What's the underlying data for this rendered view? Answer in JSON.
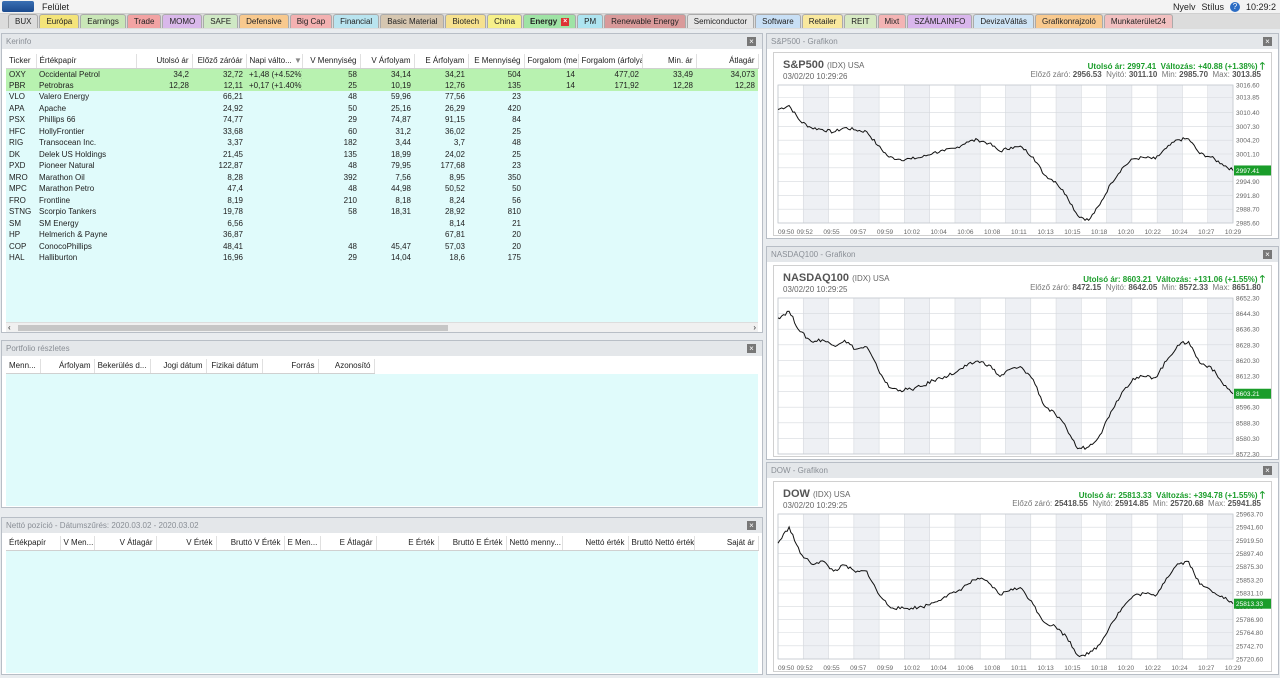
{
  "app": {
    "menu_label": "Felület",
    "lang_label": "Nyelv",
    "style_label": "Stílus",
    "time": "10:29:2"
  },
  "tabs": [
    {
      "label": "BUX",
      "color": "#dcdcdc"
    },
    {
      "label": "Európa",
      "color": "#f4e47a"
    },
    {
      "label": "Earnings",
      "color": "#c9e6b7"
    },
    {
      "label": "Trade",
      "color": "#f2a3a3"
    },
    {
      "label": "MOMO",
      "color": "#d9b8ea"
    },
    {
      "label": "SAFE",
      "color": "#cfe8c4"
    },
    {
      "label": "Defensive",
      "color": "#f8c98e"
    },
    {
      "label": "Big Cap",
      "color": "#f3b1b1"
    },
    {
      "label": "Financial",
      "color": "#b9e4ef"
    },
    {
      "label": "Basic Material",
      "color": "#d5c6b0"
    },
    {
      "label": "Biotech",
      "color": "#f6e18f"
    },
    {
      "label": "China",
      "color": "#f6f08a"
    },
    {
      "label": "Energy",
      "color": "#9fe3a5",
      "active": true
    },
    {
      "label": "PM",
      "color": "#aee4f0"
    },
    {
      "label": "Renewable Energy",
      "color": "#d99a9a"
    },
    {
      "label": "Semiconductor",
      "color": "#e6e6e6"
    },
    {
      "label": "Software",
      "color": "#c8dff5"
    },
    {
      "label": "Retailer",
      "color": "#f9e89e"
    },
    {
      "label": "REIT",
      "color": "#d7e9c3"
    },
    {
      "label": "Mixt",
      "color": "#f3b4b4"
    },
    {
      "label": "SZÁMLAINFO",
      "color": "#d9b6ec"
    },
    {
      "label": "DevizaVáltás",
      "color": "#cfe4f5"
    },
    {
      "label": "Grafikonrajzoló",
      "color": "#f8c98e"
    },
    {
      "label": "Munkaterület24",
      "color": "#f1c0c0"
    }
  ],
  "kerinfo": {
    "title": "Kerinfo",
    "columns": [
      "Ticker",
      "Értékpapír",
      "Utolsó ár",
      "Előző záróár",
      "Napi válto...",
      "V Mennyiség",
      "V Árfolyam",
      "E Árfolyam",
      "E Mennyiség",
      "Forgalom (me...",
      "Forgalom (árfolya...",
      "Min. ár",
      "Átlagár"
    ],
    "rows": [
      [
        "OXY",
        "Occidental Petrol",
        "34,2",
        "32,72",
        "+1,48 (+4.52%)",
        "58",
        "34,14",
        "34,21",
        "504",
        "14",
        "477,02",
        "33,49",
        "34,073"
      ],
      [
        "PBR",
        "Petrobras",
        "12,28",
        "12,11",
        "+0,17 (+1.40%)",
        "25",
        "10,19",
        "12,76",
        "135",
        "14",
        "171,92",
        "12,28",
        "12,28"
      ],
      [
        "VLO",
        "Valero Energy",
        "",
        "66,21",
        "",
        "48",
        "59,96",
        "77,56",
        "23",
        "",
        "",
        "",
        ""
      ],
      [
        "APA",
        "Apache",
        "",
        "24,92",
        "",
        "50",
        "25,16",
        "26,29",
        "420",
        "",
        "",
        "",
        ""
      ],
      [
        "PSX",
        "Phillips 66",
        "",
        "74,77",
        "",
        "29",
        "74,87",
        "91,15",
        "84",
        "",
        "",
        "",
        ""
      ],
      [
        "HFC",
        "HollyFrontier",
        "",
        "33,68",
        "",
        "60",
        "31,2",
        "36,02",
        "25",
        "",
        "",
        "",
        ""
      ],
      [
        "RIG",
        "Transocean Inc.",
        "",
        "3,37",
        "",
        "182",
        "3,44",
        "3,7",
        "48",
        "",
        "",
        "",
        ""
      ],
      [
        "DK",
        "Delek US Holdings",
        "",
        "21,45",
        "",
        "135",
        "18,99",
        "24,02",
        "25",
        "",
        "",
        "",
        ""
      ],
      [
        "PXD",
        "Pioneer Natural",
        "",
        "122,87",
        "",
        "48",
        "79,95",
        "177,68",
        "23",
        "",
        "",
        "",
        ""
      ],
      [
        "MRO",
        "Marathon Oil",
        "",
        "8,28",
        "",
        "392",
        "7,56",
        "8,95",
        "350",
        "",
        "",
        "",
        ""
      ],
      [
        "MPC",
        "Marathon Petro",
        "",
        "47,4",
        "",
        "48",
        "44,98",
        "50,52",
        "50",
        "",
        "",
        "",
        ""
      ],
      [
        "FRO",
        "Frontline",
        "",
        "8,19",
        "",
        "210",
        "8,18",
        "8,24",
        "56",
        "",
        "",
        "",
        ""
      ],
      [
        "STNG",
        "Scorpio Tankers",
        "",
        "19,78",
        "",
        "58",
        "18,31",
        "28,92",
        "810",
        "",
        "",
        "",
        ""
      ],
      [
        "SM",
        "SM Energy",
        "",
        "6,56",
        "",
        "",
        "",
        "8,14",
        "21",
        "",
        "",
        "",
        ""
      ],
      [
        "HP",
        "Helmerich & Payne",
        "",
        "36,87",
        "",
        "",
        "",
        "67,81",
        "20",
        "",
        "",
        "",
        ""
      ],
      [
        "COP",
        "ConocoPhillips",
        "",
        "48,41",
        "",
        "48",
        "45,47",
        "57,03",
        "20",
        "",
        "",
        "",
        ""
      ],
      [
        "HAL",
        "Halliburton",
        "",
        "16,96",
        "",
        "29",
        "14,04",
        "18,6",
        "175",
        "",
        "",
        "",
        ""
      ]
    ]
  },
  "portfolio": {
    "title": "Portfolio részletes",
    "columns": [
      "Menn...",
      "Árfolyam",
      "Bekerülés d...",
      "Jogi dátum",
      "Fizikai dátum",
      "Forrás",
      "Azonosító"
    ]
  },
  "netto": {
    "title": "Nettó pozíció - Dátumszűrés: 2020.03.02 - 2020.03.02",
    "columns": [
      "Értékpapír",
      "V Men...",
      "V Átlagár",
      "V Érték",
      "Bruttó V Érték",
      "E Men...",
      "E Átlagár",
      "E Érték",
      "Bruttó E Érték",
      "Nettó menny...",
      "Nettó érték",
      "Bruttó Nettó érték",
      "Saját ár"
    ]
  },
  "charts": [
    {
      "panel_title": "S&P500 - Grafikon",
      "name": "S&P500",
      "sub": "(IDX) USA",
      "time": "03/02/20 10:29:26",
      "last_label": "Utolsó ár:",
      "last": "2997.41",
      "chg_label": "Változás:",
      "chg": "+40.88 (+1.38%)",
      "prev_label": "Előző záró:",
      "prev": "2956.53",
      "open_label": "Nyitó:",
      "open": "3011.10",
      "min_label": "Min:",
      "min": "2985.70",
      "max_label": "Max:",
      "max": "3013.85",
      "chart_data": {
        "type": "line",
        "y_ticks": [
          "3016.60",
          "3013.85",
          "3010.40",
          "3007.30",
          "3004.20",
          "3001.10",
          "2998.00",
          "2994.90",
          "2991.80",
          "2988.70",
          "2985.60"
        ],
        "ylim": [
          2985.6,
          3016.6
        ],
        "x_ticks": [
          "09:50",
          "09:52",
          "09:55",
          "09:57",
          "09:59",
          "10:02",
          "10:04",
          "10:06",
          "10:08",
          "10:11",
          "10:13",
          "10:15",
          "10:18",
          "10:20",
          "10:22",
          "10:24",
          "10:27",
          "10:29"
        ],
        "values": [
          3011.1,
          3012.0,
          3008.5,
          3007.0,
          3006.6,
          3006.0,
          3007.0,
          3006.5,
          3006.1,
          3003.0,
          3000.4,
          2999.9,
          3000.0,
          3000.4,
          3001.4,
          3001.8,
          3002.4,
          3003.8,
          3004.3,
          3003.5,
          3001.7,
          3002.6,
          3002.6,
          3000.4,
          2996.4,
          2994.9,
          2991.8,
          2987.3,
          2986.2,
          2989.7,
          2994.5,
          2997.9,
          3000.0,
          3000.3,
          3000.0,
          3002.4,
          3004.3,
          3004.5,
          3001.2,
          3000.4,
          2998.9,
          2997.4
        ],
        "last_tag": "2997.41"
      }
    },
    {
      "panel_title": "NASDAQ100 - Grafikon",
      "name": "NASDAQ100",
      "sub": "(IDX) USA",
      "time": "03/02/20 10:29:25",
      "last_label": "Utolsó ár:",
      "last": "8603.21",
      "chg_label": "Változás:",
      "chg": "+131.06 (+1.55%)",
      "prev_label": "Előző záró:",
      "prev": "8472.15",
      "open_label": "Nyitó:",
      "open": "8642.05",
      "min_label": "Min:",
      "min": "8572.33",
      "max_label": "Max:",
      "max": "8651.80",
      "chart_data": {
        "type": "line",
        "y_ticks": [
          "8652.30",
          "8644.30",
          "8636.30",
          "8628.30",
          "8620.30",
          "8612.30",
          "8604.30",
          "8596.30",
          "8588.30",
          "8580.30",
          "8572.30"
        ],
        "ylim": [
          8572.3,
          8652.3
        ],
        "x_ticks": [],
        "values": [
          8642.1,
          8645.5,
          8635.0,
          8630.0,
          8630.9,
          8628.0,
          8630.6,
          8626.0,
          8627.2,
          8616.0,
          8606.5,
          8605.0,
          8605.5,
          8607.0,
          8610.0,
          8612.0,
          8614.0,
          8617.5,
          8620.0,
          8618.0,
          8612.0,
          8616.0,
          8616.5,
          8610.5,
          8597.0,
          8592.6,
          8585.5,
          8575.0,
          8576.0,
          8582.0,
          8594.0,
          8604.0,
          8611.0,
          8612.0,
          8611.5,
          8620.0,
          8628.0,
          8630.0,
          8619.0,
          8617.0,
          8609.0,
          8603.2
        ],
        "last_tag": "8603.21"
      }
    },
    {
      "panel_title": "DOW - Grafikon",
      "name": "DOW",
      "sub": "(IDX) USA",
      "time": "03/02/20 10:29:25",
      "last_label": "Utolsó ár:",
      "last": "25813.33",
      "chg_label": "Változás:",
      "chg": "+394.78 (+1.55%)",
      "prev_label": "Előző záró:",
      "prev": "25418.55",
      "open_label": "Nyitó:",
      "open": "25914.85",
      "min_label": "Min:",
      "min": "25720.68",
      "max_label": "Max:",
      "max": "25941.85",
      "chart_data": {
        "type": "line",
        "y_ticks": [
          "25963.70",
          "25941.60",
          "25919.50",
          "25897.40",
          "25875.30",
          "25853.20",
          "25831.10",
          "25809.00",
          "25786.90",
          "25764.80",
          "25742.70",
          "25720.60"
        ],
        "ylim": [
          25720.6,
          25963.7
        ],
        "x_ticks": [
          "09:50",
          "09:52",
          "09:55",
          "09:57",
          "09:59",
          "10:02",
          "10:04",
          "10:06",
          "10:08",
          "10:11",
          "10:13",
          "10:15",
          "10:18",
          "10:20",
          "10:22",
          "10:24",
          "10:27",
          "10:29"
        ],
        "values": [
          25914.8,
          25942.0,
          25898.0,
          25880.0,
          25885.0,
          25868.0,
          25878.0,
          25866.0,
          25868.0,
          25831.0,
          25809.0,
          25805.0,
          25806.0,
          25808.0,
          25815.0,
          25825.0,
          25832.0,
          25845.0,
          25856.0,
          25848.0,
          25828.0,
          25838.0,
          25838.0,
          25812.0,
          25782.0,
          25775.0,
          25758.0,
          25727.0,
          25729.0,
          25745.0,
          25779.0,
          25806.0,
          25826.0,
          25831.0,
          25826.0,
          25856.0,
          25880.0,
          25884.0,
          25846.0,
          25836.0,
          25826.0,
          25813.3
        ],
        "last_tag": "25813.33"
      }
    }
  ]
}
